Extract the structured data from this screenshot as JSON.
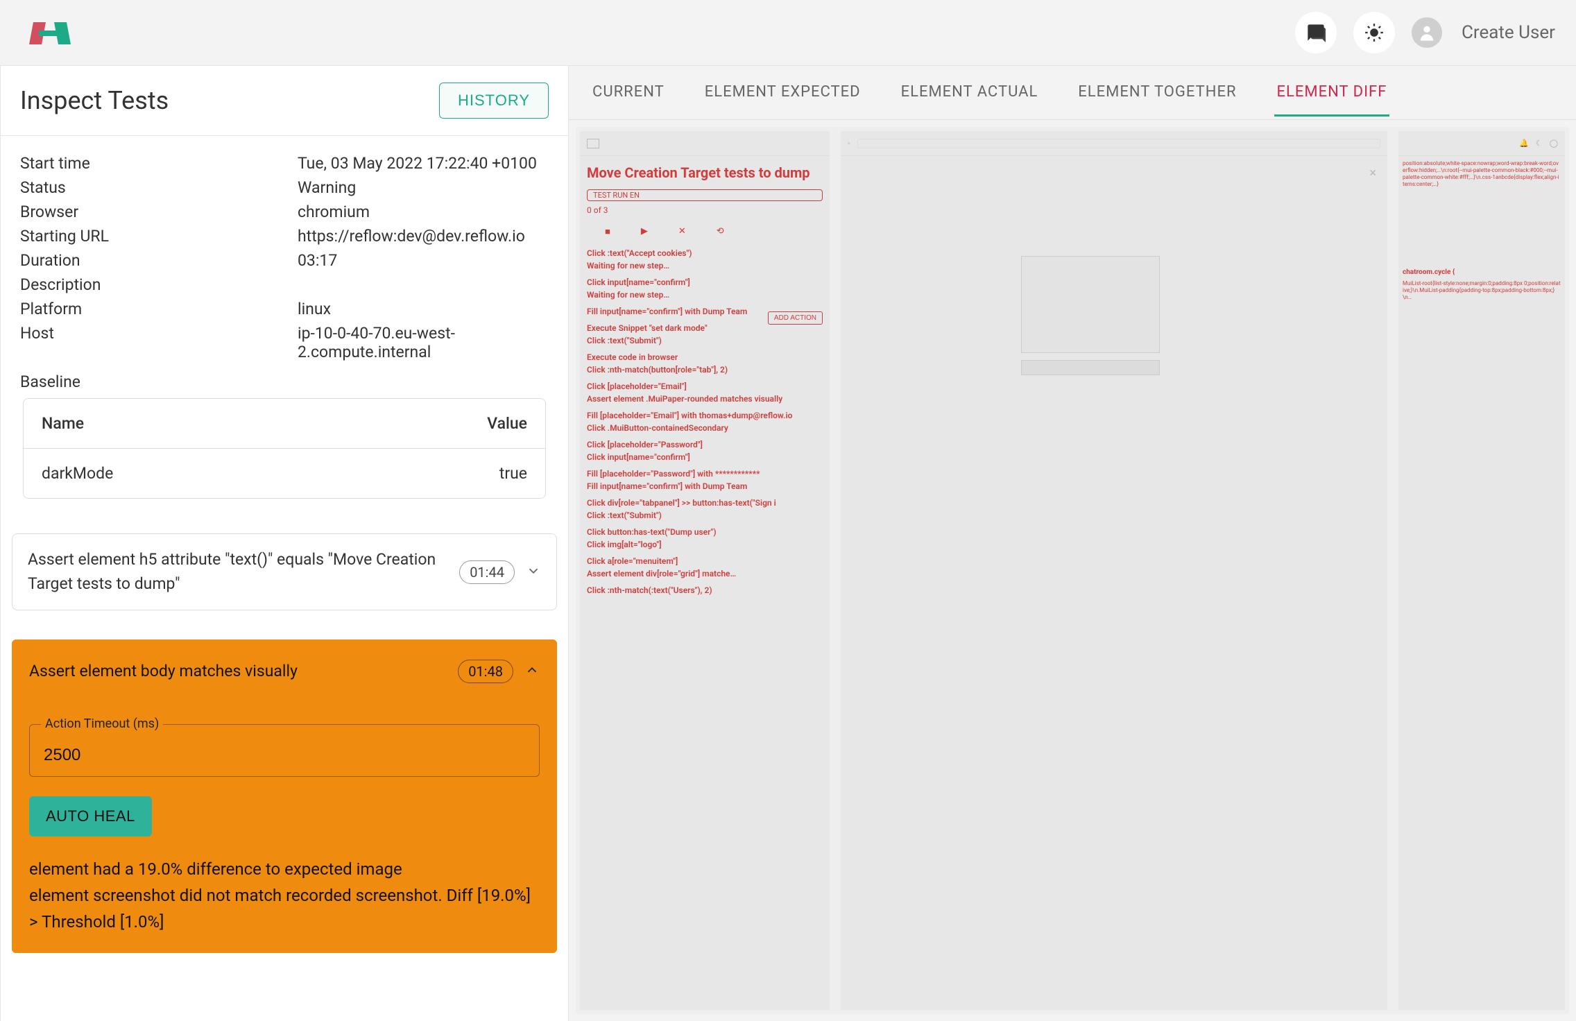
{
  "topbar": {
    "create_user": "Create User"
  },
  "left": {
    "title": "Inspect Tests",
    "history_btn": "HISTORY",
    "details": {
      "start_time_label": "Start time",
      "start_time": "Tue, 03 May 2022 17:22:40 +0100",
      "status_label": "Status",
      "status": "Warning",
      "browser_label": "Browser",
      "browser": "chromium",
      "starting_url_label": "Starting URL",
      "starting_url": "https://reflow:dev@dev.reflow.io",
      "duration_label": "Duration",
      "duration": "03:17",
      "description_label": "Description",
      "description": "",
      "platform_label": "Platform",
      "platform": "linux",
      "host_label": "Host",
      "host": "ip-10-0-40-70.eu-west-2.compute.internal",
      "baseline_label": "Baseline",
      "baseline_name_header": "Name",
      "baseline_value_header": "Value",
      "baseline_rows": [
        {
          "name": "darkMode",
          "value": "true"
        }
      ]
    },
    "steps": [
      {
        "text": "Assert element h5 attribute \"text()\" equals \"Move Creation Target tests to dump\"",
        "time": "01:44",
        "expanded": false
      },
      {
        "text": "Assert element body matches visually",
        "time": "01:48",
        "expanded": true,
        "action_timeout_label": "Action Timeout (ms)",
        "action_timeout_value": "2500",
        "auto_heal": "AUTO HEAL",
        "error_line1": "element had a 19.0% difference to expected image",
        "error_line2": "element screenshot did not match recorded screenshot. Diff [19.0%] > Threshold [1.0%]"
      }
    ]
  },
  "tabs": {
    "items": [
      "CURRENT",
      "ELEMENT EXPECTED",
      "ELEMENT ACTUAL",
      "ELEMENT TOGETHER",
      "ELEMENT DIFF"
    ],
    "active_index": 4
  },
  "diff": {
    "title": "Move Creation Target tests to dump",
    "subtitle": "0 of 3",
    "pill": "TEST RUN EN",
    "controls": [
      "■",
      "▶",
      "✕",
      "⟲"
    ],
    "add_action_btn": "ADD ACTION",
    "left_lines": [
      "Click :text(\"Accept cookies\")",
      "Waiting for new step…",
      "",
      "Click input[name=\"confirm\"]",
      "Waiting for new step…",
      "",
      "Fill input[name=\"confirm\"] with Dump Team",
      "",
      "Execute Snippet \"set dark mode\"",
      "Click :text(\"Submit\")",
      "",
      "Execute code in browser",
      "Click :nth-match(button[role=\"tab\"], 2)",
      "",
      "Click [placeholder=\"Email\"]",
      "Assert element .MuiPaper-rounded matches visually",
      "",
      "Fill [placeholder=\"Email\"] with thomas+dump@reflow.io",
      "Click .MuiButton-containedSecondary",
      "",
      "Click [placeholder=\"Password\"]",
      "Click input[name=\"confirm\"]",
      "",
      "Fill [placeholder=\"Password\"] with ************",
      "Fill input[name=\"confirm\"] with Dump Team",
      "",
      "Click div[role=\"tabpanel\"] >> button:has-text(\"Sign i",
      "Click :text(\"Submit\")",
      "",
      "Click button:has-text(\"Dump user\")",
      "Click img[alt=\"logo\"]",
      "",
      "Click a[role=\"menuitem\"]",
      "Assert element div[role=\"grid\"] matche…",
      "",
      "Click :nth-match(:text(\"Users\"), 2)"
    ],
    "right_header": "chatroom.cycle {",
    "right_lines_block": "position:absolute;white-space:nowrap;word-wrap:break-word;overflow:hidden;…\\n:root{--mui-palette-common-black:#000;--mui-palette-common-white:#fff;…}\\n.css-1anbcde{display:flex;align-items:center;…}",
    "right_lines_block2": "MuiList-root{list-style:none;margin:0;padding:8px 0;position:relative;}\\n.MuiList-padding{padding-top:8px;padding-bottom:8px;}\\n…"
  }
}
